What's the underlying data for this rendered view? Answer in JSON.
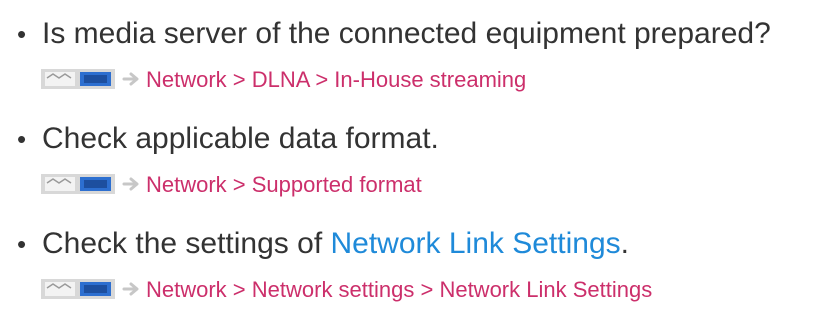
{
  "items": [
    {
      "bullet": "•",
      "text": "Is media server of the connected equipment prepared?",
      "path": "Network > DLNA > In-House streaming"
    },
    {
      "bullet": "•",
      "text": "Check applicable data format.",
      "path": "Network > Supported format"
    },
    {
      "bullet": "•",
      "text_before": "Check the settings of ",
      "link": "Network Link Settings",
      "text_after": ".",
      "path": "Network > Network settings > Network Link Settings"
    }
  ],
  "icons": {
    "menu": "tv-menu-icon",
    "arrow": "right-arrow-icon"
  },
  "colors": {
    "body_text": "#333333",
    "path_text": "#cc2f6b",
    "link_text": "#1f8ad9",
    "icon_blue": "#2d6fd0",
    "icon_gray": "#c7c7c7"
  }
}
